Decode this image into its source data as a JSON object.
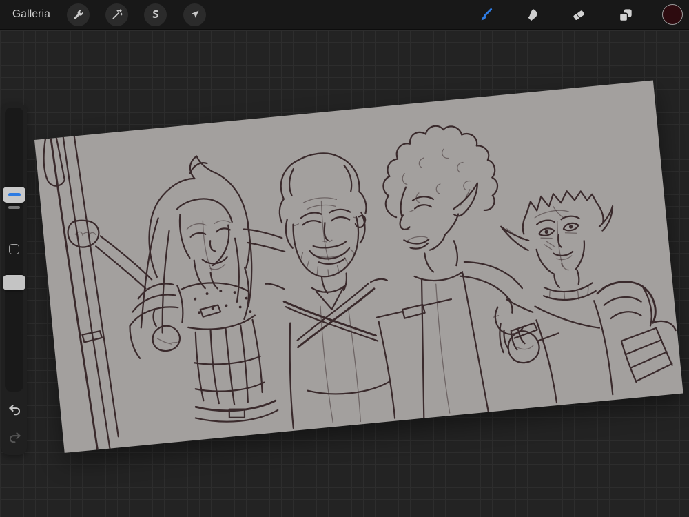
{
  "theme": {
    "bg": "#232323",
    "grid": "#2d2d2d",
    "topbar": "#181818",
    "button-circle": "#2b2b2b",
    "panel": "#202020",
    "track": "#191919",
    "handle": "#c9c9c9",
    "icon": "#c9c9c9",
    "icon-dim": "#555555",
    "text": "#d6d6d6",
    "accent": "#2e7ce3",
    "paper": "#a3a09e",
    "ink": "#3a2a2c",
    "swatch": "#2d0b0f"
  },
  "topbar": {
    "gallery_label": "Galleria",
    "left_tools": [
      {
        "id": "actions",
        "icon": "wrench-icon"
      },
      {
        "id": "adjustments",
        "icon": "magic-wand-icon"
      },
      {
        "id": "selection",
        "icon": "selection-s-icon"
      },
      {
        "id": "transform",
        "icon": "transform-arrow-icon"
      }
    ],
    "right_tools": [
      {
        "id": "paint",
        "icon": "paintbrush-icon",
        "active": true,
        "active_color": "#2e7ce3"
      },
      {
        "id": "smudge",
        "icon": "smudge-finger-icon",
        "active": false
      },
      {
        "id": "erase",
        "icon": "eraser-icon",
        "active": false
      },
      {
        "id": "layers",
        "icon": "layers-icon",
        "active": false
      },
      {
        "id": "color",
        "icon": "color-swatch",
        "swatch_color": "#2d0b0f"
      }
    ]
  },
  "sidebar": {
    "size_slider": {
      "handle_position": 0.29,
      "indicator_color": "#2e7ce3"
    },
    "opacity_slider": {
      "handle_position": 0.6
    },
    "controls": [
      "brush-size-slider",
      "modify-button",
      "opacity-slider",
      "undo-button",
      "redo-button"
    ],
    "undo_enabled": true,
    "redo_enabled": false
  },
  "canvas": {
    "paper_color": "#a3a09e",
    "line_color": "#3a2a2c",
    "rotation_deg": -5.5,
    "artwork_description": "Monochrome line sketch of four fantasy adventurers posing arm in arm",
    "figures": [
      "long-haired woman smiling with eyes closed, armored shoulder, gripping a staff",
      "bearded man with wavy hair laughing, crossed straps over chest",
      "elf with curly afro hair and pointed ears, serene expression",
      "short-haired elf in plate armor with wide eyes and smirk, hand dangling over shoulder"
    ]
  }
}
